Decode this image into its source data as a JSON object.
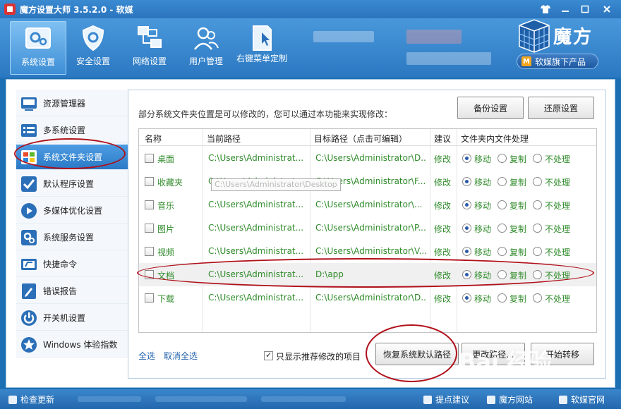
{
  "window": {
    "title": "魔方设置大师 3.5.2.0 - 软媒",
    "controls": [
      "shirt-icon",
      "minimize",
      "maximize",
      "close"
    ]
  },
  "toolbar": {
    "items": [
      {
        "label": "系统设置",
        "icon": "gear-icon",
        "active": true
      },
      {
        "label": "安全设置",
        "icon": "shield-icon",
        "active": false
      },
      {
        "label": "网络设置",
        "icon": "network-icon",
        "active": false
      },
      {
        "label": "用户管理",
        "icon": "users-icon",
        "active": false
      },
      {
        "label": "右键菜单定制",
        "icon": "context-menu-icon",
        "active": false
      }
    ],
    "brand": "魔方",
    "brand_badge": "软媒旗下产品"
  },
  "sidebar": {
    "items": [
      {
        "label": "资源管理器",
        "icon": "monitor-icon",
        "active": false
      },
      {
        "label": "多系统设置",
        "icon": "multi-system-icon",
        "active": false
      },
      {
        "label": "系统文件夹设置",
        "icon": "windows-icon",
        "active": true
      },
      {
        "label": "默认程序设置",
        "icon": "check-icon",
        "active": false
      },
      {
        "label": "多媒体优化设置",
        "icon": "media-icon",
        "active": false
      },
      {
        "label": "系统服务设置",
        "icon": "service-icon",
        "active": false
      },
      {
        "label": "快捷命令",
        "icon": "shortcut-icon",
        "active": false
      },
      {
        "label": "错误报告",
        "icon": "report-icon",
        "active": false
      },
      {
        "label": "开关机设置",
        "icon": "power-icon",
        "active": false
      },
      {
        "label": "Windows 体验指数",
        "icon": "star-icon",
        "active": false
      }
    ]
  },
  "panel": {
    "description": "部分系统文件夹位置是可以修改的，您可以通过本功能来实现修改：",
    "backup_button": "备份设置",
    "restore_button": "还原设置",
    "table": {
      "headers": [
        "名称",
        "当前路径",
        "目标路径（点击可编辑）",
        "建议",
        "文件夹内文件处理"
      ],
      "options": [
        "移动",
        "复制",
        "不处理"
      ],
      "rows": [
        {
          "name": "桌面",
          "current": "C:\\Users\\Administrat...",
          "target": "C:\\Users\\Administrator\\D...",
          "suggest": "修改",
          "selected": 0
        },
        {
          "name": "收藏夹",
          "current": "C:\\Users\\Administrat...",
          "target": "C:\\Users\\Administrator\\F...",
          "suggest": "修改",
          "selected": 0
        },
        {
          "name": "音乐",
          "current": "C:\\Users\\Administrat...",
          "target": "C:\\Users\\Administrator\\...",
          "suggest": "修改",
          "selected": 0
        },
        {
          "name": "图片",
          "current": "C:\\Users\\Administrat...",
          "target": "C:\\Users\\Administrator\\P...",
          "suggest": "修改",
          "selected": 0
        },
        {
          "name": "视频",
          "current": "C:\\Users\\Administrat...",
          "target": "C:\\Users\\Administrator\\V...",
          "suggest": "修改",
          "selected": 0
        },
        {
          "name": "文档",
          "current": "C:\\Users\\Administrat...",
          "target": "D:\\app",
          "suggest": "修改",
          "selected": 0
        },
        {
          "name": "下载",
          "current": "C:\\Users\\Administrat...",
          "target": "C:\\Users\\Administrator\\D...",
          "suggest": "修改",
          "selected": 0
        }
      ],
      "tooltip": "C:\\Users\\Administrator\\Desktop"
    },
    "select_all": "全选",
    "deselect_all": "取消全选",
    "only_recommended": "只显示推荐修改的项目",
    "restore_default_button": "恢复系统默认路径",
    "change_path_button": "更改路径...",
    "start_button": "开始转移"
  },
  "statusbar": {
    "check_update": "检查更新",
    "feedback": "提点建议",
    "mofang_site": "魔方网站",
    "ruanmei_site": "软媒官网"
  },
  "watermark": "Bai 经验",
  "colors": {
    "accent": "#2b79c6",
    "path_green": "#2f8b2a",
    "annotation_red": "#b0111b"
  }
}
